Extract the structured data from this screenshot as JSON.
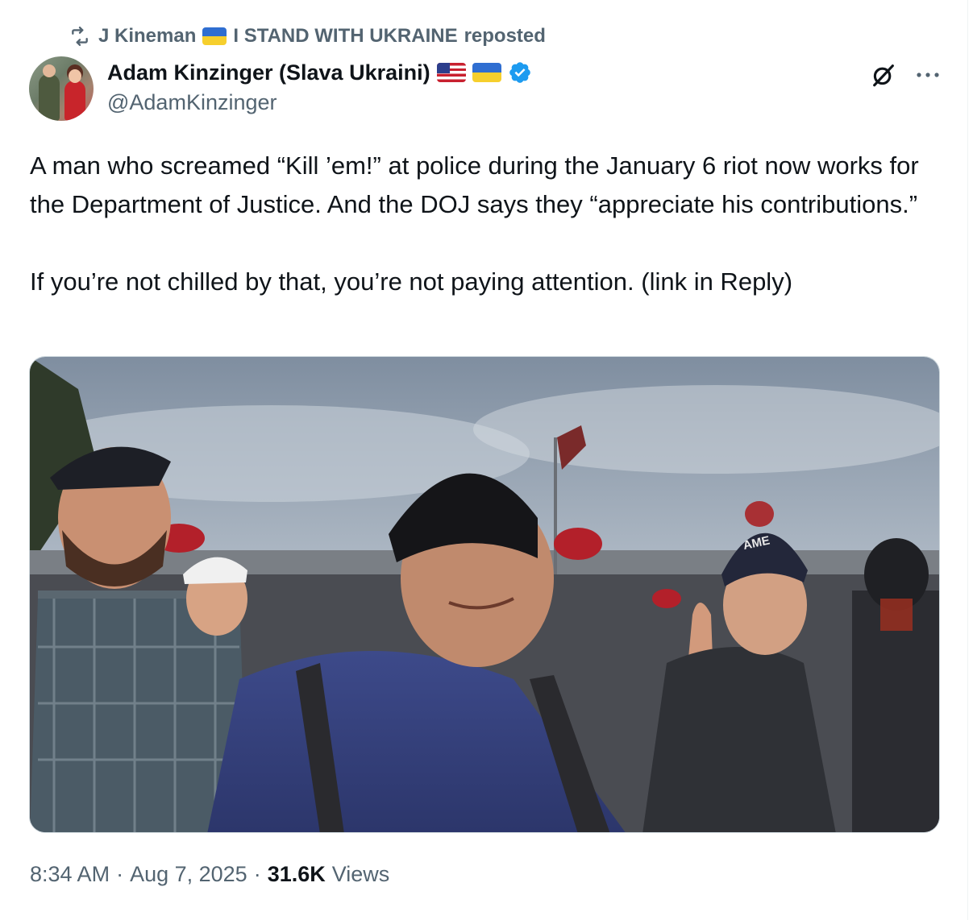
{
  "repost": {
    "icon": "repost-icon",
    "user_name": "J Kineman",
    "flag": "ukraine-flag",
    "user_suffix": "I STAND WITH UKRAINE",
    "label": "reposted"
  },
  "author": {
    "display_name": "Adam Kinzinger (Slava Ukraini)",
    "flags": [
      "us-flag",
      "ukraine-flag"
    ],
    "verified": true,
    "handle": "@AdamKinzinger"
  },
  "tweet": {
    "paragraphs": [
      "A man who screamed “Kill ’em!” at police during the January 6 riot now works for the Department of Justice. And the DOJ says they “appreciate his contributions.”",
      "If you’re not chilled by that, you’re not paying attention. (link in Reply)"
    ]
  },
  "footer": {
    "time": "8:34 AM",
    "separator": "·",
    "date": "Aug 7, 2025",
    "views_count": "31.6K",
    "views_label": "Views"
  },
  "colors": {
    "text": "#0f1419",
    "secondary": "#536471",
    "verified": "#1d9bf0",
    "border": "#cfd9de"
  }
}
